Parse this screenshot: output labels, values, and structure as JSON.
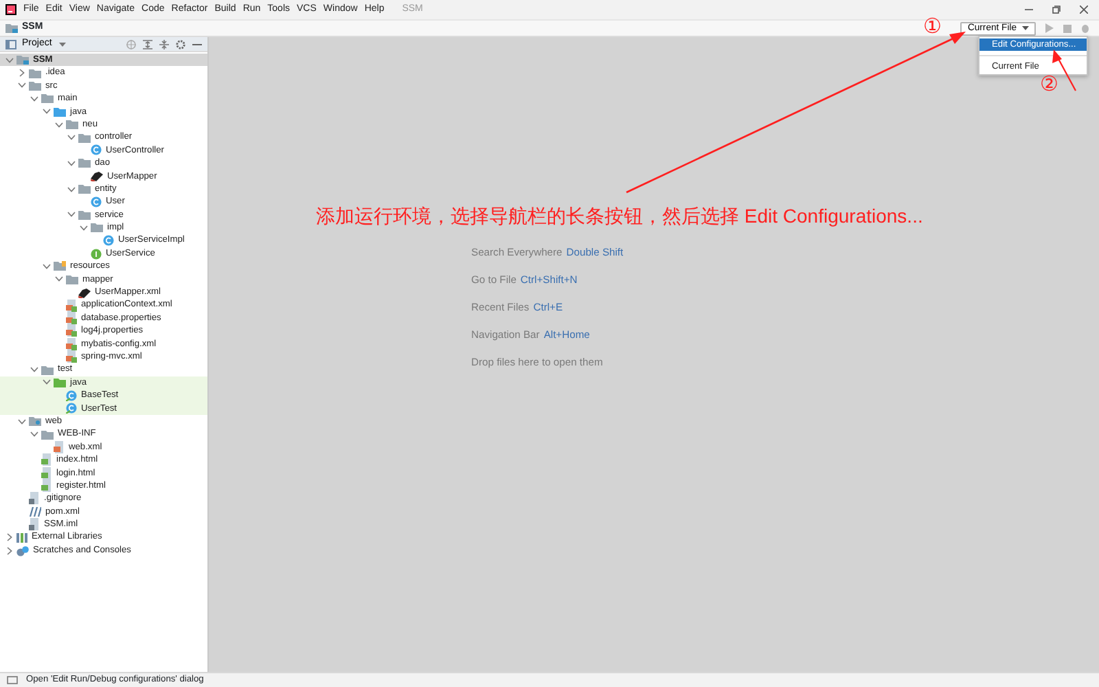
{
  "menu_bar": {
    "items": [
      "File",
      "Edit",
      "View",
      "Navigate",
      "Code",
      "Refactor",
      "Build",
      "Run",
      "Tools",
      "VCS",
      "Window",
      "Help"
    ],
    "project_title": "SSM"
  },
  "navigation_bar": {
    "breadcrumb": "SSM",
    "run_configuration": "Current File",
    "dropdown": [
      {
        "label": "Edit Configurations...",
        "selected": true
      },
      {
        "label": "Current File",
        "selected": false
      }
    ]
  },
  "project_panel": {
    "title": "Project",
    "tree": [
      {
        "label": "SSM",
        "kind": "project",
        "expanded": true,
        "selected": true,
        "highlighted": false,
        "children": [
          {
            "label": ".idea",
            "kind": "folder",
            "expanded": false,
            "selected": false,
            "highlighted": false
          },
          {
            "label": "src",
            "kind": "folder",
            "expanded": true,
            "selected": false,
            "highlighted": false,
            "children": [
              {
                "label": "main",
                "kind": "folder",
                "expanded": true,
                "selected": false,
                "highlighted": false,
                "children": [
                  {
                    "label": "java",
                    "kind": "source-folder",
                    "expanded": true,
                    "selected": false,
                    "highlighted": false,
                    "children": [
                      {
                        "label": "neu",
                        "kind": "folder",
                        "expanded": true,
                        "selected": false,
                        "highlighted": false,
                        "children": [
                          {
                            "label": "controller",
                            "kind": "folder",
                            "expanded": true,
                            "selected": false,
                            "highlighted": false,
                            "children": [
                              {
                                "label": "UserController",
                                "kind": "class",
                                "selected": false,
                                "highlighted": false
                              }
                            ]
                          },
                          {
                            "label": "dao",
                            "kind": "folder",
                            "expanded": true,
                            "selected": false,
                            "highlighted": false,
                            "children": [
                              {
                                "label": "UserMapper",
                                "kind": "mybatis",
                                "selected": false,
                                "highlighted": false
                              }
                            ]
                          },
                          {
                            "label": "entity",
                            "kind": "folder",
                            "expanded": true,
                            "selected": false,
                            "highlighted": false,
                            "children": [
                              {
                                "label": "User",
                                "kind": "class",
                                "selected": false,
                                "highlighted": false
                              }
                            ]
                          },
                          {
                            "label": "service",
                            "kind": "folder",
                            "expanded": true,
                            "selected": false,
                            "highlighted": false,
                            "children": [
                              {
                                "label": "impl",
                                "kind": "folder",
                                "expanded": true,
                                "selected": false,
                                "highlighted": false,
                                "children": [
                                  {
                                    "label": "UserServiceImpl",
                                    "kind": "class",
                                    "selected": false,
                                    "highlighted": false
                                  }
                                ]
                              },
                              {
                                "label": "UserService",
                                "kind": "interface",
                                "selected": false,
                                "highlighted": false
                              }
                            ]
                          }
                        ]
                      }
                    ]
                  },
                  {
                    "label": "resources",
                    "kind": "resources-folder",
                    "expanded": true,
                    "selected": false,
                    "highlighted": false,
                    "children": [
                      {
                        "label": "mapper",
                        "kind": "folder",
                        "expanded": true,
                        "selected": false,
                        "highlighted": false,
                        "children": [
                          {
                            "label": "UserMapper.xml",
                            "kind": "mybatis",
                            "selected": false,
                            "highlighted": false
                          }
                        ]
                      },
                      {
                        "label": "applicationContext.xml",
                        "kind": "config",
                        "selected": false,
                        "highlighted": false
                      },
                      {
                        "label": "database.properties",
                        "kind": "config",
                        "selected": false,
                        "highlighted": false
                      },
                      {
                        "label": "log4j.properties",
                        "kind": "config",
                        "selected": false,
                        "highlighted": false
                      },
                      {
                        "label": "mybatis-config.xml",
                        "kind": "config",
                        "selected": false,
                        "highlighted": false
                      },
                      {
                        "label": "spring-mvc.xml",
                        "kind": "config",
                        "selected": false,
                        "highlighted": false
                      }
                    ]
                  }
                ]
              },
              {
                "label": "test",
                "kind": "folder",
                "expanded": true,
                "selected": false,
                "highlighted": false,
                "children": [
                  {
                    "label": "java",
                    "kind": "test-folder",
                    "expanded": true,
                    "selected": false,
                    "highlighted": true,
                    "children": [
                      {
                        "label": "BaseTest",
                        "kind": "test-class",
                        "selected": false,
                        "highlighted": true
                      },
                      {
                        "label": "UserTest",
                        "kind": "test-class",
                        "selected": false,
                        "highlighted": true
                      }
                    ]
                  }
                ]
              }
            ]
          },
          {
            "label": "web",
            "kind": "web-folder",
            "expanded": true,
            "selected": false,
            "highlighted": false,
            "children": [
              {
                "label": "WEB-INF",
                "kind": "folder",
                "expanded": true,
                "selected": false,
                "highlighted": false,
                "children": [
                  {
                    "label": "web.xml",
                    "kind": "xml",
                    "selected": false,
                    "highlighted": false
                  }
                ]
              },
              {
                "label": "index.html",
                "kind": "html",
                "selected": false,
                "highlighted": false
              },
              {
                "label": "login.html",
                "kind": "html",
                "selected": false,
                "highlighted": false
              },
              {
                "label": "register.html",
                "kind": "html",
                "selected": false,
                "highlighted": false
              }
            ]
          },
          {
            "label": ".gitignore",
            "kind": "text",
            "selected": false,
            "highlighted": false
          },
          {
            "label": "pom.xml",
            "kind": "maven",
            "selected": false,
            "highlighted": false
          },
          {
            "label": "SSM.iml",
            "kind": "text",
            "selected": false,
            "highlighted": false
          }
        ]
      },
      {
        "label": "External Libraries",
        "kind": "library",
        "expanded": false,
        "selected": false,
        "highlighted": false
      },
      {
        "label": "Scratches and Consoles",
        "kind": "scratches",
        "expanded": false,
        "selected": false,
        "highlighted": false
      }
    ]
  },
  "editor": {
    "hints": [
      {
        "action": "Search Everywhere",
        "shortcut": "Double Shift"
      },
      {
        "action": "Go to File",
        "shortcut": "Ctrl+Shift+N"
      },
      {
        "action": "Recent Files",
        "shortcut": "Ctrl+E"
      },
      {
        "action": "Navigation Bar",
        "shortcut": "Alt+Home"
      },
      {
        "action": "Drop files here to open them"
      }
    ]
  },
  "annotations": {
    "instruction": "添加运行环境，选择导航栏的长条按钮，然后选择 Edit Configurations...",
    "step_markers": [
      "①",
      "②"
    ]
  },
  "status_bar": {
    "message": "Open 'Edit Run/Debug configurations' dialog"
  }
}
